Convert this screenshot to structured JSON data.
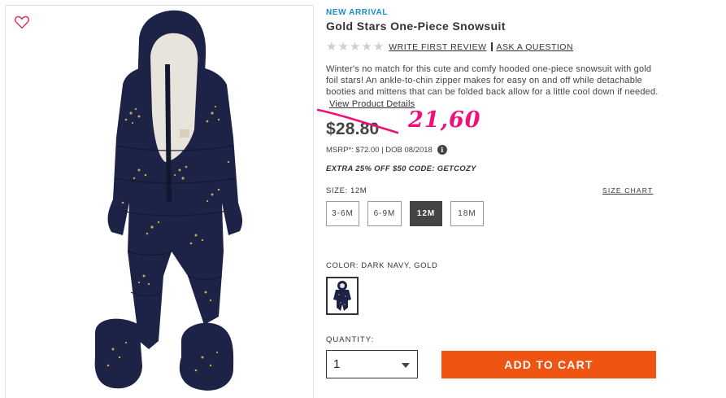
{
  "product": {
    "badge": "NEW ARRIVAL",
    "title": "Gold Stars One-Piece Snowsuit",
    "rating_stars": 5,
    "write_review": "WRITE FIRST REVIEW",
    "ask_question": "ASK A QUESTION",
    "description": "Winter's no match for this cute and comfy hooded one-piece snowsuit with gold foil stars! An ankle-to-chin zipper makes for easy on and off while detachable booties and mittens that can be folded back allow for a little cool down if needed.",
    "view_details": "View Product Details",
    "price": "$28.80",
    "handwritten_price": "21,60",
    "msrp": "MSRP*: $72.00 | DOB 08/2018",
    "info_glyph": "i",
    "promo": "EXTRA 25% OFF $50 CODE: GETCOZY"
  },
  "size": {
    "label": "SIZE:",
    "selected": "12M",
    "chart_link": "SIZE CHART",
    "options": [
      "3-6M",
      "6-9M",
      "12M",
      "18M"
    ]
  },
  "color": {
    "label": "COLOR:",
    "value": "DARK NAVY, GOLD",
    "swatch_color": "#1c2347"
  },
  "quantity": {
    "label": "QUANTITY:",
    "value": "1"
  },
  "actions": {
    "add_to_cart": "ADD TO CART"
  },
  "colors": {
    "accent_blue": "#1a8dd1",
    "cart_orange": "#f05412",
    "annotation_pink": "#f0107a",
    "navy": "#1c2347",
    "gold": "#c9a64f"
  },
  "icons": {
    "wishlist": "heart-icon",
    "dropdown": "chevron-down-icon",
    "info": "info-icon"
  }
}
